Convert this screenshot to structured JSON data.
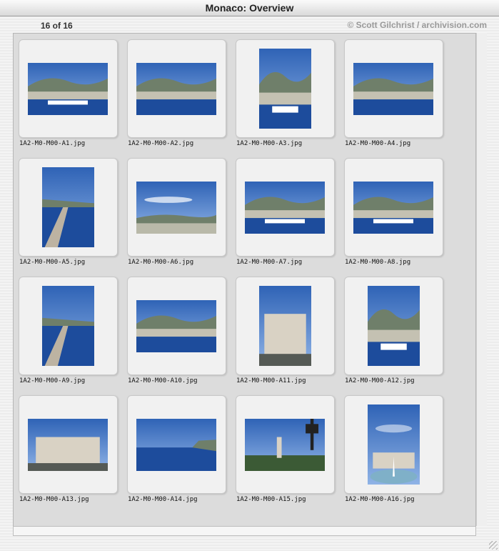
{
  "window": {
    "title": "Monaco: Overview"
  },
  "info": {
    "count": "16 of 16",
    "credit": "© Scott Gilchrist / archivision.com"
  },
  "thumbnails": [
    {
      "filename": "1A2-M0-M00-A1.jpg",
      "orientation": "landscape",
      "scene": "harbor-city"
    },
    {
      "filename": "1A2-M0-M00-A2.jpg",
      "orientation": "landscape",
      "scene": "coast-hills"
    },
    {
      "filename": "1A2-M0-M00-A3.jpg",
      "orientation": "portrait",
      "scene": "yacht-harbor"
    },
    {
      "filename": "1A2-M0-M00-A4.jpg",
      "orientation": "landscape",
      "scene": "waterfront"
    },
    {
      "filename": "1A2-M0-M00-A5.jpg",
      "orientation": "portrait",
      "scene": "breakwater"
    },
    {
      "filename": "1A2-M0-M00-A6.jpg",
      "orientation": "landscape",
      "scene": "sky-city"
    },
    {
      "filename": "1A2-M0-M00-A7.jpg",
      "orientation": "landscape",
      "scene": "harbor-city"
    },
    {
      "filename": "1A2-M0-M00-A8.jpg",
      "orientation": "landscape",
      "scene": "harbor-city"
    },
    {
      "filename": "1A2-M0-M00-A9.jpg",
      "orientation": "portrait",
      "scene": "breakwater"
    },
    {
      "filename": "1A2-M0-M00-A10.jpg",
      "orientation": "landscape",
      "scene": "waterfront"
    },
    {
      "filename": "1A2-M0-M00-A11.jpg",
      "orientation": "portrait",
      "scene": "buildings"
    },
    {
      "filename": "1A2-M0-M00-A12.jpg",
      "orientation": "portrait",
      "scene": "yacht-harbor"
    },
    {
      "filename": "1A2-M0-M00-A13.jpg",
      "orientation": "landscape",
      "scene": "buildings"
    },
    {
      "filename": "1A2-M0-M00-A14.jpg",
      "orientation": "landscape",
      "scene": "sea-cliff"
    },
    {
      "filename": "1A2-M0-M00-A15.jpg",
      "orientation": "landscape",
      "scene": "lamp-park"
    },
    {
      "filename": "1A2-M0-M00-A16.jpg",
      "orientation": "portrait",
      "scene": "casino-fountain"
    }
  ],
  "colors": {
    "sky": "#2f63b6",
    "sky_light": "#8fb3e6",
    "sea": "#1d4c9c",
    "land": "#6f7f6a",
    "buildings": "#d9d2c4"
  }
}
